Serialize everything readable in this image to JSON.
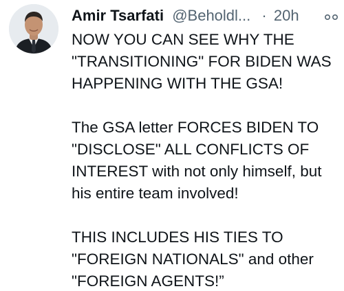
{
  "tweet": {
    "author_name": "Amir Tsarfati",
    "handle": "@Beholdl...",
    "separator": "·",
    "time": "20h",
    "avatar_icon": "profile-photo",
    "more_icon": "more-options-icon",
    "paragraphs": [
      "NOW YOU CAN SEE WHY THE \"TRANSITIONING\" FOR BIDEN WAS HAPPENING WITH THE GSA!",
      "The GSA letter FORCES BIDEN TO \"DISCLOSE\" ALL CONFLICTS OF INTEREST with not only himself, but his entire team involved!",
      "THIS INCLUDES HIS TIES TO \"FOREIGN NATIONALS\" and other \"FOREIGN AGENTS!”"
    ]
  }
}
